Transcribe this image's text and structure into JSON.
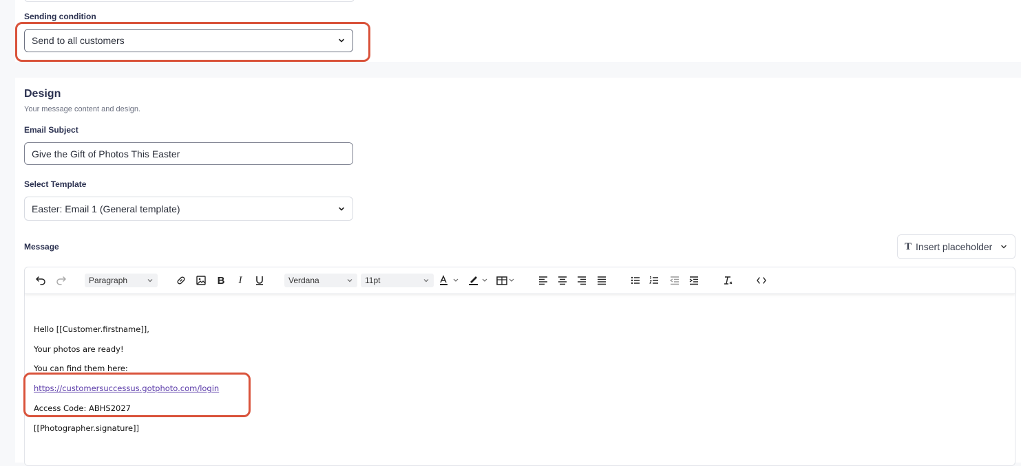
{
  "sending": {
    "label": "Sending condition",
    "value": "Send to all customers"
  },
  "design": {
    "title": "Design",
    "subtitle": "Your message content and design.",
    "subject_label": "Email Subject",
    "subject_value": "Give the Gift of Photos This Easter",
    "template_label": "Select Template",
    "template_value": "Easter: Email 1 (General template)",
    "message_label": "Message",
    "insert_placeholder": "Insert placeholder",
    "insert_placeholder_icon": "T"
  },
  "toolbar": {
    "block_format": "Paragraph",
    "font_family": "Verdana",
    "font_size": "11pt",
    "icons": [
      "undo-icon",
      "redo-icon",
      "link-icon",
      "image-icon",
      "bold-icon",
      "italic-icon",
      "underline-icon",
      "text-color-icon",
      "highlight-icon",
      "table-icon",
      "align-left-icon",
      "align-center-icon",
      "align-right-icon",
      "align-justify-icon",
      "bullet-list-icon",
      "numbered-list-icon",
      "outdent-icon",
      "indent-icon",
      "clear-format-icon",
      "source-code-icon"
    ]
  },
  "message": {
    "greeting": "Hello [[Customer.firstname]],",
    "line1": "Your photos are ready!",
    "line2": "You can find them here:",
    "link": "https://customersuccessus.gotphoto.com/login",
    "access_code": "Access Code: ABHS2027",
    "signature": "[[Photographer.signature]]"
  },
  "colors": {
    "highlight": "#d9533b",
    "link": "#5a3aa8",
    "heading": "#2b3150"
  }
}
